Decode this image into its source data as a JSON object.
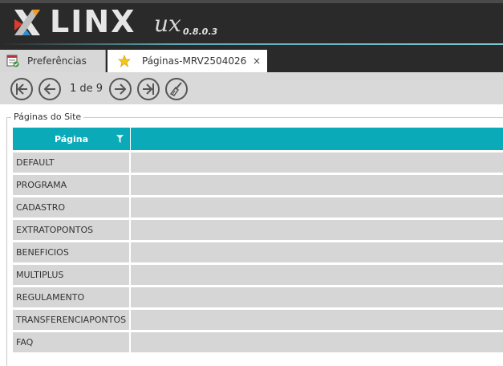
{
  "header": {
    "brand": "LINX",
    "product": "ux",
    "version": "0.8.0.3"
  },
  "tabs": [
    {
      "label": "Preferências",
      "icon": "preferences-icon",
      "active": false
    },
    {
      "label": "Páginas-MRV2504026",
      "icon": "star-icon",
      "active": true,
      "close": "×"
    }
  ],
  "toolbar": {
    "page_info": "1 de 9",
    "buttons": [
      "first-page-icon",
      "previous-page-icon",
      "next-page-icon",
      "last-page-icon",
      "clear-icon"
    ]
  },
  "group": {
    "legend": "Páginas do Site"
  },
  "grid": {
    "column_header": "Página",
    "rows": [
      "DEFAULT",
      "PROGRAMA",
      "CADASTRO",
      "EXTRATOPONTOS",
      "BENEFICIOS",
      "MULTIPLUS",
      "REGULAMENTO",
      "TRANSFERENCIAPONTOS",
      "FAQ"
    ]
  },
  "colors": {
    "header_bg": "#2a2a2a",
    "grid_header": "#0aaab8",
    "row_bg": "#d7d6d6",
    "toolbar_bg": "#d9d9d9"
  }
}
